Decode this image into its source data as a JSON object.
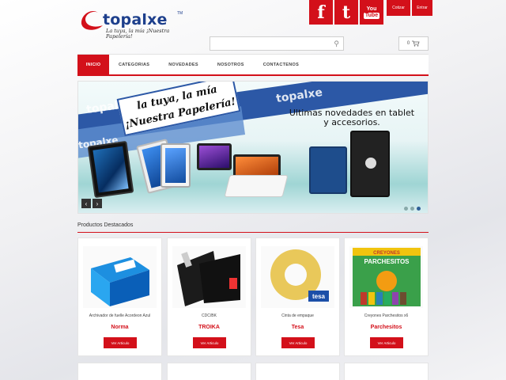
{
  "header": {
    "logo": {
      "word": "topalxe",
      "tm": "TM",
      "tagline": "La tuya, la mía ¡Nuestra Papelería!"
    },
    "social": [
      {
        "name": "facebook-icon",
        "label": "f"
      },
      {
        "name": "twitter-icon",
        "label": "t"
      },
      {
        "name": "youtube-icon",
        "label_top": "You",
        "label_bottom": "Tube"
      }
    ],
    "links": [
      "Cotizar",
      "Entrar"
    ],
    "search": {
      "placeholder": ""
    },
    "cart": {
      "count": "0"
    },
    "colors": {
      "brand_red": "#d3101a",
      "brand_blue": "#1d3f8c"
    }
  },
  "nav": {
    "items": [
      "INICIO",
      "CATEGORIAS",
      "NOVEDADES",
      "NOSOTROS",
      "CONTACTENOS"
    ],
    "active": "INICIO"
  },
  "banner": {
    "tag": "la tuya, la mía ¡Nuestra Papelería!",
    "watermark": "topalxe",
    "headline": "Ultimas novedades en tablet y accesorios.",
    "prev": "‹",
    "next": "›",
    "slides": 3,
    "current_slide": 3
  },
  "featured": {
    "title": "Productos Destacados",
    "products": [
      {
        "name": "Archivador de fuelle Acordeon Azul",
        "brand": "Norma",
        "button": "Ver Articulo"
      },
      {
        "name": "CDC/BK",
        "brand": "TROIKA",
        "button": "Ver Articulo"
      },
      {
        "name": "Cinta de empaque",
        "brand": "Tesa",
        "button": "Ver Articulo"
      },
      {
        "name": "Creyones Parchesitos x6",
        "brand": "Parchesitos",
        "button": "Ver Articulo"
      }
    ],
    "product_art": {
      "tesa_label": "tesa",
      "creyones_label": "CREYONES",
      "parchesitos_label": "PARCHESITOS"
    }
  }
}
